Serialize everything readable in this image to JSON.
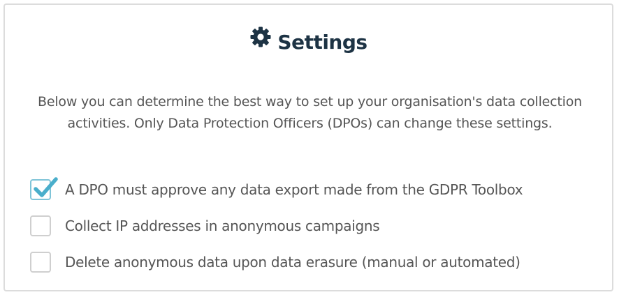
{
  "settings": {
    "title": "Settings",
    "icon": "gear-icon",
    "description": "Below you can determine the best way to set up your organisation's data collection activities. Only Data Protection Officers (DPOs) can change these settings.",
    "options": [
      {
        "label": "A DPO must approve any data export made from the GDPR Toolbox",
        "checked": true
      },
      {
        "label": "Collect IP addresses in anonymous campaigns",
        "checked": false
      },
      {
        "label": "Delete anonymous data upon data erasure (manual or automated)",
        "checked": false
      }
    ]
  },
  "colors": {
    "title": "#1d3344",
    "text": "#555555",
    "checkmark": "#4aaecb",
    "checkbox_border": "#cfcfcf",
    "panel_border": "#dcdcdc"
  }
}
